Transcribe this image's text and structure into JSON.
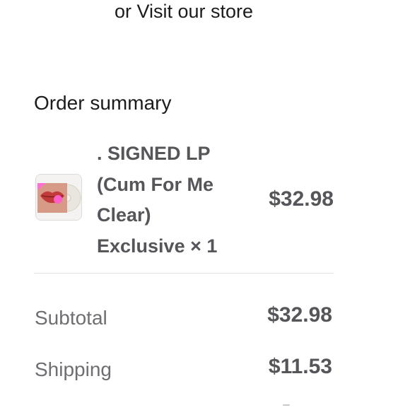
{
  "store_link": {
    "label": "or Visit our store"
  },
  "order_summary": {
    "title": "Order summary",
    "line_items": [
      {
        "name": ". SIGNED LP (Cum For Me Clear) Exclusive × 1",
        "price": "$32.98",
        "thumbnail_icon": "vinyl-record-lips-artwork"
      }
    ],
    "subtotal": {
      "label": "Subtotal",
      "value": "$32.98"
    },
    "shipping": {
      "label": "Shipping",
      "value": "$11.53"
    }
  },
  "colors": {
    "text_primary": "#1c1c1e",
    "text_secondary": "#6e6e73",
    "text_bold_gray": "#55555a",
    "divider": "#e2e2e6",
    "thumb_border": "#d9d9de"
  }
}
